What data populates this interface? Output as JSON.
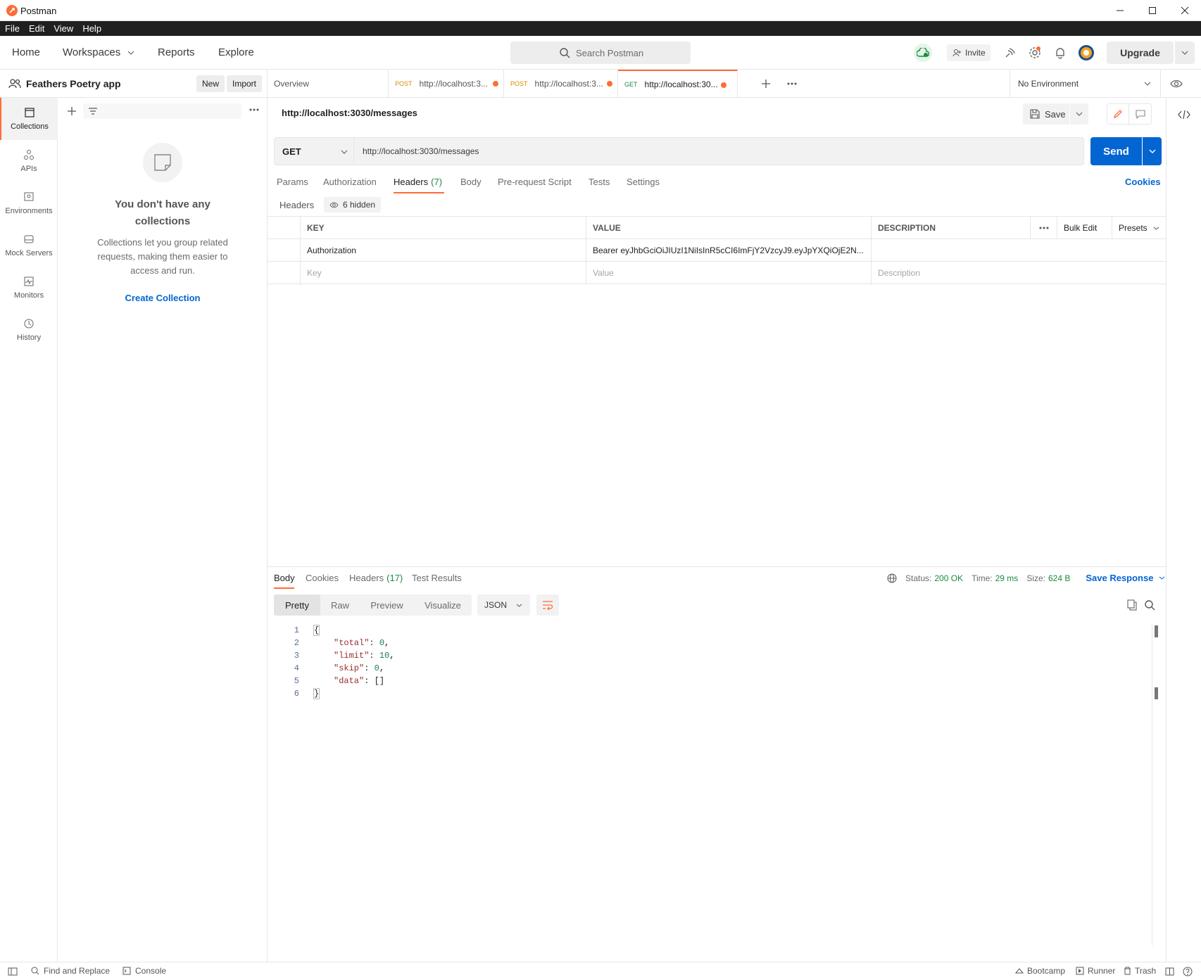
{
  "window": {
    "title": "Postman"
  },
  "menu": [
    "File",
    "Edit",
    "View",
    "Help"
  ],
  "header": {
    "nav": {
      "home": "Home",
      "workspaces": "Workspaces",
      "reports": "Reports",
      "explore": "Explore"
    },
    "search_placeholder": "Search Postman",
    "invite": "Invite",
    "upgrade": "Upgrade"
  },
  "workspace": {
    "name": "Feathers Poetry app",
    "new": "New",
    "import": "Import"
  },
  "leftnav": [
    {
      "label": "Collections",
      "icon": "collections-icon"
    },
    {
      "label": "APIs",
      "icon": "apis-icon"
    },
    {
      "label": "Environments",
      "icon": "environments-icon"
    },
    {
      "label": "Mock Servers",
      "icon": "mock-servers-icon"
    },
    {
      "label": "Monitors",
      "icon": "monitors-icon"
    },
    {
      "label": "History",
      "icon": "history-icon"
    }
  ],
  "collections_empty": {
    "title": "You don't have any collections",
    "text": "Collections let you group related requests, making them easier to access and run.",
    "cta": "Create Collection"
  },
  "tabs": [
    {
      "label": "Overview"
    },
    {
      "method": "POST",
      "label": "http://localhost:3..."
    },
    {
      "method": "POST",
      "label": "http://localhost:3..."
    },
    {
      "method": "GET",
      "label": "http://localhost:30..."
    }
  ],
  "environment": "No Environment",
  "request": {
    "name": "http://localhost:3030/messages",
    "save": "Save",
    "method": "GET",
    "url": "http://localhost:3030/messages",
    "send": "Send",
    "tabs": {
      "params": "Params",
      "authorization": "Authorization",
      "headers": "Headers",
      "headers_count": "(7)",
      "body": "Body",
      "prerequest": "Pre-request Script",
      "tests": "Tests",
      "settings": "Settings"
    },
    "cookies": "Cookies",
    "headers_label": "Headers",
    "hidden": "6 hidden"
  },
  "headers_table": {
    "columns": {
      "key": "KEY",
      "value": "VALUE",
      "description": "DESCRIPTION"
    },
    "bulk_edit": "Bulk Edit",
    "presets": "Presets",
    "rows": [
      {
        "checked": true,
        "key": "Authorization",
        "value": "Bearer eyJhbGciOiJIUzI1NiIsInR5cCI6ImFjY2VzcyJ9.eyJpYXQiOjE2N...",
        "description": ""
      }
    ],
    "placeholders": {
      "key": "Key",
      "value": "Value",
      "description": "Description"
    }
  },
  "response": {
    "tabs": {
      "body": "Body",
      "cookies": "Cookies",
      "headers": "Headers",
      "headers_count": "(17)",
      "test_results": "Test Results"
    },
    "status_label": "Status:",
    "status": "200 OK",
    "time_label": "Time:",
    "time": "29 ms",
    "size_label": "Size:",
    "size": "624 B",
    "save_response": "Save Response",
    "views": [
      "Pretty",
      "Raw",
      "Preview",
      "Visualize"
    ],
    "format": "JSON",
    "lines": [
      {
        "n": "1",
        "text": "{"
      },
      {
        "n": "2",
        "key": "\"total\"",
        "val": "0",
        "tail": ","
      },
      {
        "n": "3",
        "key": "\"limit\"",
        "val": "10",
        "tail": ","
      },
      {
        "n": "4",
        "key": "\"skip\"",
        "val": "0",
        "tail": ","
      },
      {
        "n": "5",
        "key": "\"data\"",
        "val": "[]",
        "tail": ""
      },
      {
        "n": "6",
        "text": "}"
      }
    ]
  },
  "statusbar": {
    "find_replace": "Find and Replace",
    "console": "Console",
    "bootcamp": "Bootcamp",
    "runner": "Runner",
    "trash": "Trash"
  },
  "colors": {
    "accent": "#ff6c37",
    "primary": "#0265d2",
    "success": "#1d8a3f"
  }
}
